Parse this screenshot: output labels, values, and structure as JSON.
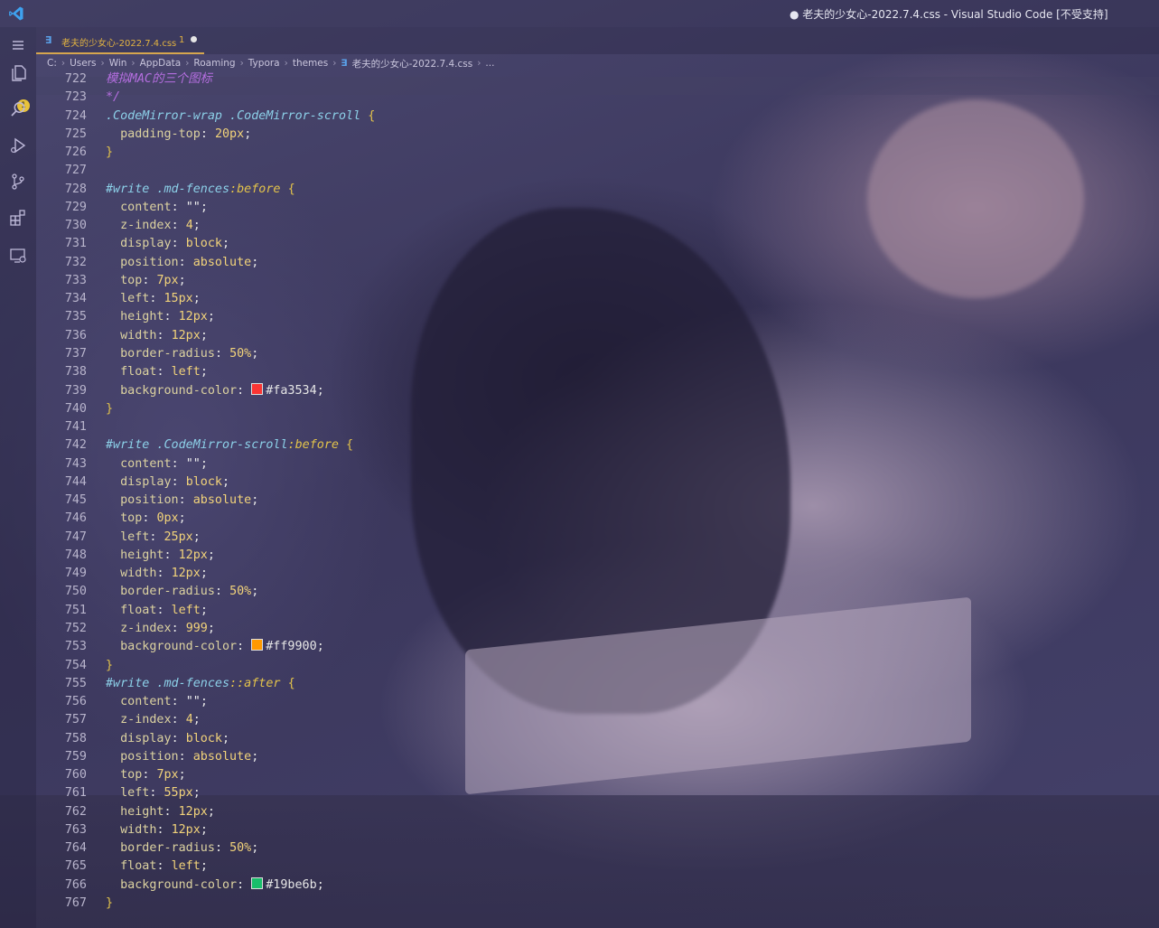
{
  "window": {
    "title": "● 老夫的少女心-2022.7.4.css - Visual Studio Code [不受支持]"
  },
  "activity_bar": {
    "items": [
      "menu-icon",
      "explorer-icon",
      "search-icon",
      "run-debug-icon",
      "source-control-icon",
      "extensions-icon",
      "remote-explorer-icon"
    ],
    "explorer_badge": "1"
  },
  "tab": {
    "label": "老夫的少女心-2022.7.4.css",
    "problem_count": "1"
  },
  "breadcrumb": {
    "items": [
      "C:",
      "Users",
      "Win",
      "AppData",
      "Roaming",
      "Typora",
      "themes",
      "老夫的少女心-2022.7.4.css",
      "..."
    ]
  },
  "colors": {
    "red": "#fa3534",
    "orange": "#ff9900",
    "green": "#19be6b",
    "accent_tab": "#d6a64e"
  },
  "lines": [
    {
      "n": "722",
      "segs": [
        {
          "t": "模拟MAC的三个图标",
          "c": "cm"
        }
      ]
    },
    {
      "n": "723",
      "segs": [
        {
          "t": "*/",
          "c": "cm"
        }
      ]
    },
    {
      "n": "724",
      "segs": [
        {
          "t": ".CodeMirror-wrap .CodeMirror-scroll ",
          "c": "sel"
        },
        {
          "t": "{",
          "c": "brace"
        }
      ]
    },
    {
      "n": "725",
      "segs": [
        {
          "t": "  padding-top",
          "c": "prop"
        },
        {
          "t": ": ",
          "c": "hash"
        },
        {
          "t": "20px",
          "c": "num"
        },
        {
          "t": ";",
          "c": "hash"
        }
      ]
    },
    {
      "n": "726",
      "segs": [
        {
          "t": "}",
          "c": "brace"
        }
      ]
    },
    {
      "n": "727",
      "segs": []
    },
    {
      "n": "728",
      "segs": [
        {
          "t": "#write .md-fences",
          "c": "sel"
        },
        {
          "t": ":before ",
          "c": "pseudo"
        },
        {
          "t": "{",
          "c": "brace"
        }
      ]
    },
    {
      "n": "729",
      "segs": [
        {
          "t": "  content",
          "c": "prop"
        },
        {
          "t": ": ",
          "c": "hash"
        },
        {
          "t": "\"\"",
          "c": "str"
        },
        {
          "t": ";",
          "c": "hash"
        }
      ]
    },
    {
      "n": "730",
      "segs": [
        {
          "t": "  z-index",
          "c": "prop"
        },
        {
          "t": ": ",
          "c": "hash"
        },
        {
          "t": "4",
          "c": "num"
        },
        {
          "t": ";",
          "c": "hash"
        }
      ]
    },
    {
      "n": "731",
      "segs": [
        {
          "t": "  display",
          "c": "prop"
        },
        {
          "t": ": ",
          "c": "hash"
        },
        {
          "t": "block",
          "c": "val"
        },
        {
          "t": ";",
          "c": "hash"
        }
      ]
    },
    {
      "n": "732",
      "segs": [
        {
          "t": "  position",
          "c": "prop"
        },
        {
          "t": ": ",
          "c": "hash"
        },
        {
          "t": "absolute",
          "c": "val"
        },
        {
          "t": ";",
          "c": "hash"
        }
      ]
    },
    {
      "n": "733",
      "segs": [
        {
          "t": "  top",
          "c": "prop"
        },
        {
          "t": ": ",
          "c": "hash"
        },
        {
          "t": "7px",
          "c": "num"
        },
        {
          "t": ";",
          "c": "hash"
        }
      ]
    },
    {
      "n": "734",
      "segs": [
        {
          "t": "  left",
          "c": "prop"
        },
        {
          "t": ": ",
          "c": "hash"
        },
        {
          "t": "15px",
          "c": "num"
        },
        {
          "t": ";",
          "c": "hash"
        }
      ]
    },
    {
      "n": "735",
      "segs": [
        {
          "t": "  height",
          "c": "prop"
        },
        {
          "t": ": ",
          "c": "hash"
        },
        {
          "t": "12px",
          "c": "num"
        },
        {
          "t": ";",
          "c": "hash"
        }
      ]
    },
    {
      "n": "736",
      "segs": [
        {
          "t": "  width",
          "c": "prop"
        },
        {
          "t": ": ",
          "c": "hash"
        },
        {
          "t": "12px",
          "c": "num"
        },
        {
          "t": ";",
          "c": "hash"
        }
      ]
    },
    {
      "n": "737",
      "segs": [
        {
          "t": "  border-radius",
          "c": "prop"
        },
        {
          "t": ": ",
          "c": "hash"
        },
        {
          "t": "50%",
          "c": "num"
        },
        {
          "t": ";",
          "c": "hash"
        }
      ]
    },
    {
      "n": "738",
      "segs": [
        {
          "t": "  float",
          "c": "prop"
        },
        {
          "t": ": ",
          "c": "hash"
        },
        {
          "t": "left",
          "c": "val"
        },
        {
          "t": ";",
          "c": "hash"
        }
      ]
    },
    {
      "n": "739",
      "segs": [
        {
          "t": "  background-color",
          "c": "prop"
        },
        {
          "t": ": ",
          "c": "hash"
        },
        {
          "sw": "#fa3534"
        },
        {
          "t": "#fa3534",
          "c": "hash"
        },
        {
          "t": ";",
          "c": "hash"
        }
      ]
    },
    {
      "n": "740",
      "segs": [
        {
          "t": "}",
          "c": "brace"
        }
      ]
    },
    {
      "n": "741",
      "segs": []
    },
    {
      "n": "742",
      "segs": [
        {
          "t": "#write .CodeMirror-scroll",
          "c": "sel"
        },
        {
          "t": ":before ",
          "c": "pseudo"
        },
        {
          "t": "{",
          "c": "brace"
        }
      ]
    },
    {
      "n": "743",
      "segs": [
        {
          "t": "  content",
          "c": "prop"
        },
        {
          "t": ": ",
          "c": "hash"
        },
        {
          "t": "\"\"",
          "c": "str"
        },
        {
          "t": ";",
          "c": "hash"
        }
      ]
    },
    {
      "n": "744",
      "segs": [
        {
          "t": "  display",
          "c": "prop"
        },
        {
          "t": ": ",
          "c": "hash"
        },
        {
          "t": "block",
          "c": "val"
        },
        {
          "t": ";",
          "c": "hash"
        }
      ]
    },
    {
      "n": "745",
      "segs": [
        {
          "t": "  position",
          "c": "prop"
        },
        {
          "t": ": ",
          "c": "hash"
        },
        {
          "t": "absolute",
          "c": "val"
        },
        {
          "t": ";",
          "c": "hash"
        }
      ]
    },
    {
      "n": "746",
      "segs": [
        {
          "t": "  top",
          "c": "prop"
        },
        {
          "t": ": ",
          "c": "hash"
        },
        {
          "t": "0px",
          "c": "num"
        },
        {
          "t": ";",
          "c": "hash"
        }
      ]
    },
    {
      "n": "747",
      "segs": [
        {
          "t": "  left",
          "c": "prop"
        },
        {
          "t": ": ",
          "c": "hash"
        },
        {
          "t": "25px",
          "c": "num"
        },
        {
          "t": ";",
          "c": "hash"
        }
      ]
    },
    {
      "n": "748",
      "segs": [
        {
          "t": "  height",
          "c": "prop"
        },
        {
          "t": ": ",
          "c": "hash"
        },
        {
          "t": "12px",
          "c": "num"
        },
        {
          "t": ";",
          "c": "hash"
        }
      ]
    },
    {
      "n": "749",
      "segs": [
        {
          "t": "  width",
          "c": "prop"
        },
        {
          "t": ": ",
          "c": "hash"
        },
        {
          "t": "12px",
          "c": "num"
        },
        {
          "t": ";",
          "c": "hash"
        }
      ]
    },
    {
      "n": "750",
      "segs": [
        {
          "t": "  border-radius",
          "c": "prop"
        },
        {
          "t": ": ",
          "c": "hash"
        },
        {
          "t": "50%",
          "c": "num"
        },
        {
          "t": ";",
          "c": "hash"
        }
      ]
    },
    {
      "n": "751",
      "segs": [
        {
          "t": "  float",
          "c": "prop"
        },
        {
          "t": ": ",
          "c": "hash"
        },
        {
          "t": "left",
          "c": "val"
        },
        {
          "t": ";",
          "c": "hash"
        }
      ]
    },
    {
      "n": "752",
      "segs": [
        {
          "t": "  z-index",
          "c": "prop"
        },
        {
          "t": ": ",
          "c": "hash"
        },
        {
          "t": "999",
          "c": "num"
        },
        {
          "t": ";",
          "c": "hash"
        }
      ]
    },
    {
      "n": "753",
      "segs": [
        {
          "t": "  background-color",
          "c": "prop"
        },
        {
          "t": ": ",
          "c": "hash"
        },
        {
          "sw": "#ff9900"
        },
        {
          "t": "#ff9900",
          "c": "hash"
        },
        {
          "t": ";",
          "c": "hash"
        }
      ]
    },
    {
      "n": "754",
      "segs": [
        {
          "t": "}",
          "c": "brace"
        }
      ]
    },
    {
      "n": "755",
      "segs": [
        {
          "t": "#write .md-fences",
          "c": "sel"
        },
        {
          "t": "::after ",
          "c": "pseudo"
        },
        {
          "t": "{",
          "c": "brace"
        }
      ]
    },
    {
      "n": "756",
      "segs": [
        {
          "t": "  content",
          "c": "prop"
        },
        {
          "t": ": ",
          "c": "hash"
        },
        {
          "t": "\"\"",
          "c": "str"
        },
        {
          "t": ";",
          "c": "hash"
        }
      ]
    },
    {
      "n": "757",
      "segs": [
        {
          "t": "  z-index",
          "c": "prop"
        },
        {
          "t": ": ",
          "c": "hash"
        },
        {
          "t": "4",
          "c": "num"
        },
        {
          "t": ";",
          "c": "hash"
        }
      ]
    },
    {
      "n": "758",
      "segs": [
        {
          "t": "  display",
          "c": "prop"
        },
        {
          "t": ": ",
          "c": "hash"
        },
        {
          "t": "block",
          "c": "val"
        },
        {
          "t": ";",
          "c": "hash"
        }
      ]
    },
    {
      "n": "759",
      "segs": [
        {
          "t": "  position",
          "c": "prop"
        },
        {
          "t": ": ",
          "c": "hash"
        },
        {
          "t": "absolute",
          "c": "val"
        },
        {
          "t": ";",
          "c": "hash"
        }
      ]
    },
    {
      "n": "760",
      "segs": [
        {
          "t": "  top",
          "c": "prop"
        },
        {
          "t": ": ",
          "c": "hash"
        },
        {
          "t": "7px",
          "c": "num"
        },
        {
          "t": ";",
          "c": "hash"
        }
      ]
    },
    {
      "n": "761",
      "segs": [
        {
          "t": "  left",
          "c": "prop"
        },
        {
          "t": ": ",
          "c": "hash"
        },
        {
          "t": "55px",
          "c": "num"
        },
        {
          "t": ";",
          "c": "hash"
        }
      ]
    },
    {
      "n": "762",
      "segs": [
        {
          "t": "  height",
          "c": "prop"
        },
        {
          "t": ": ",
          "c": "hash"
        },
        {
          "t": "12px",
          "c": "num"
        },
        {
          "t": ";",
          "c": "hash"
        }
      ]
    },
    {
      "n": "763",
      "segs": [
        {
          "t": "  width",
          "c": "prop"
        },
        {
          "t": ": ",
          "c": "hash"
        },
        {
          "t": "12px",
          "c": "num"
        },
        {
          "t": ";",
          "c": "hash"
        }
      ]
    },
    {
      "n": "764",
      "segs": [
        {
          "t": "  border-radius",
          "c": "prop"
        },
        {
          "t": ": ",
          "c": "hash"
        },
        {
          "t": "50%",
          "c": "num"
        },
        {
          "t": ";",
          "c": "hash"
        }
      ]
    },
    {
      "n": "765",
      "segs": [
        {
          "t": "  float",
          "c": "prop"
        },
        {
          "t": ": ",
          "c": "hash"
        },
        {
          "t": "left",
          "c": "val"
        },
        {
          "t": ";",
          "c": "hash"
        }
      ]
    },
    {
      "n": "766",
      "segs": [
        {
          "t": "  background-color",
          "c": "prop"
        },
        {
          "t": ": ",
          "c": "hash"
        },
        {
          "sw": "#19be6b"
        },
        {
          "t": "#19be6b",
          "c": "hash"
        },
        {
          "t": ";",
          "c": "hash"
        }
      ]
    },
    {
      "n": "767",
      "segs": [
        {
          "t": "}",
          "c": "brace"
        }
      ]
    }
  ]
}
